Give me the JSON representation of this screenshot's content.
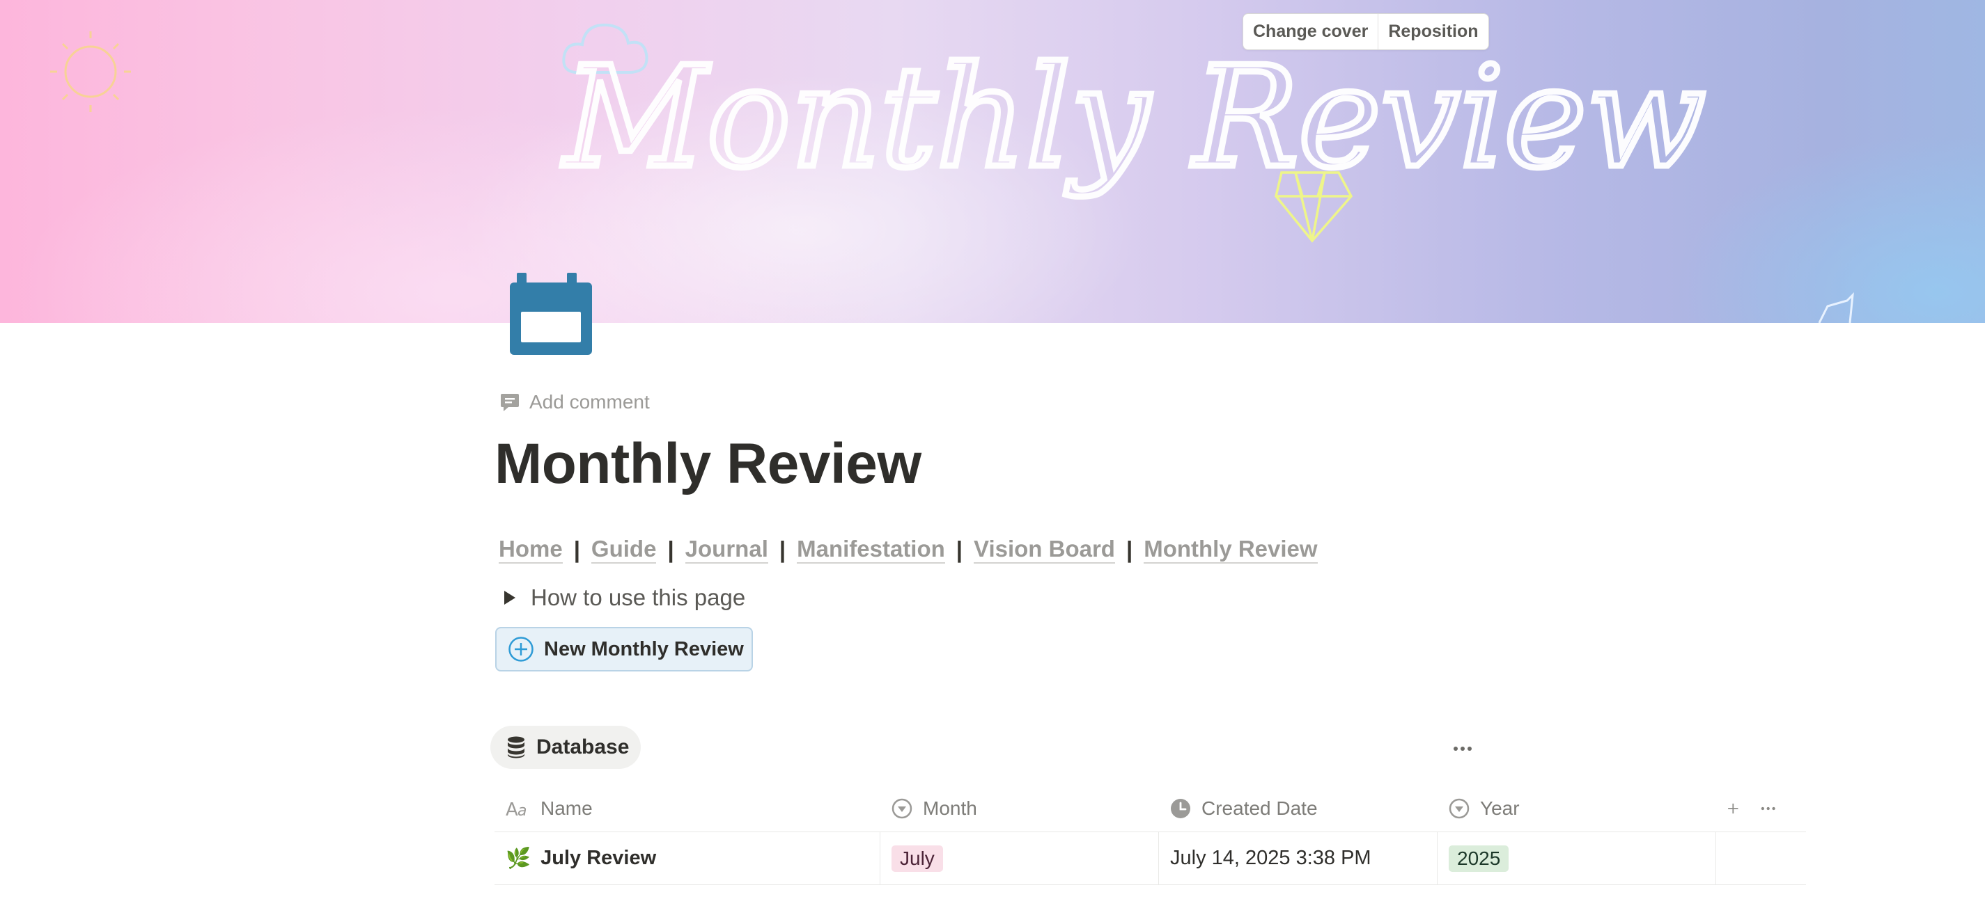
{
  "cover": {
    "title_art": "Monthly Review",
    "change_cover_label": "Change cover",
    "reposition_label": "Reposition"
  },
  "page": {
    "icon": "calendar-icon",
    "add_comment_label": "Add comment",
    "title": "Monthly Review"
  },
  "nav": {
    "links": [
      "Home",
      "Guide",
      "Journal",
      "Manifestation",
      "Vision Board",
      "Monthly Review"
    ],
    "separator": "|"
  },
  "toggle": {
    "label": "How to use this page"
  },
  "new_button": {
    "label": "New Monthly Review"
  },
  "database": {
    "view_label": "Database",
    "columns": [
      {
        "label": "Name",
        "icon": "text-property-icon"
      },
      {
        "label": "Month",
        "icon": "select-property-icon"
      },
      {
        "label": "Created Date",
        "icon": "clock-icon"
      },
      {
        "label": "Year",
        "icon": "select-property-icon"
      }
    ],
    "rows": [
      {
        "emoji": "🌿",
        "name": "July Review",
        "month": "July",
        "created": "July 14, 2025 3:38 PM",
        "year": "2025"
      }
    ]
  },
  "colors": {
    "month_tag_bg": "#f9dfe8",
    "year_tag_bg": "#dbeddb",
    "new_button_bg": "#e7f1f8",
    "icon_blue": "#337ea9"
  }
}
